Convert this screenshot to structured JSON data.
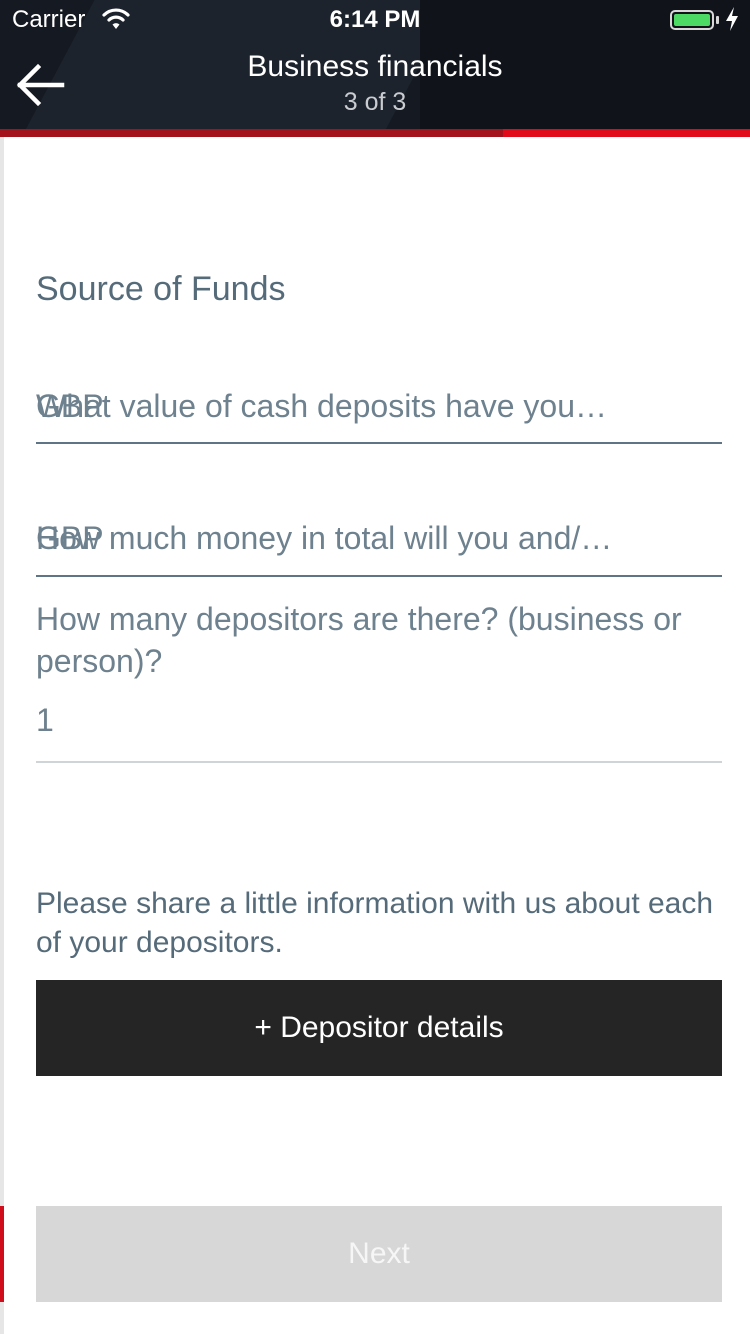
{
  "status_bar": {
    "carrier": "Carrier",
    "time": "6:14 PM",
    "battery_level": 1.0
  },
  "header": {
    "title": "Business financials",
    "step": "3 of 3",
    "back_icon": "arrow-left-icon",
    "progress": 0.67
  },
  "form": {
    "section_title": "Source of Funds",
    "cash_deposits": {
      "prefix": "GBP",
      "placeholder": "What value of cash deposits have you…"
    },
    "total_money": {
      "prefix": "GBP",
      "placeholder": "How much money in total will you and/…"
    },
    "depositors": {
      "label": "How many depositors are there? (business or person)?",
      "value": "1"
    },
    "info_text": "Please share a little information with us about each of your depositors.",
    "depositor_button": "+ Depositor details",
    "next_button": "Next"
  },
  "colors": {
    "header_bg": "#151a22",
    "accent_red": "#e10a1b",
    "text_slate": "#566b7a",
    "button_dark": "#252525",
    "button_disabled": "#d7d7d7"
  }
}
